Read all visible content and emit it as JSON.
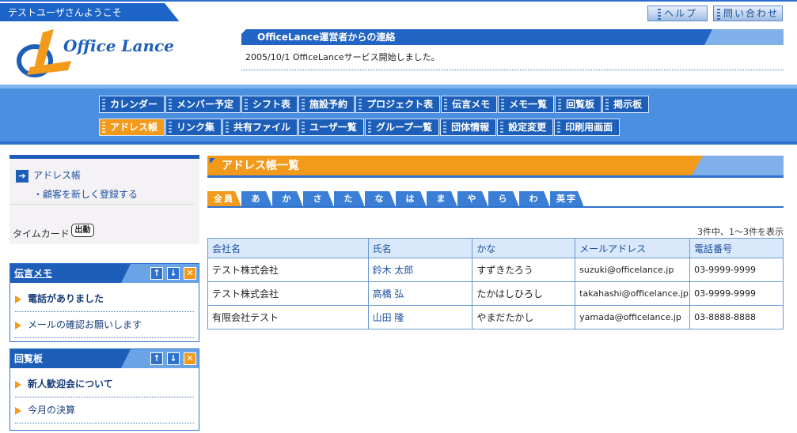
{
  "topbar": {
    "welcome": "テストユーザさんようこそ",
    "help_label": "ヘルプ",
    "contact_label": "問い合わせ"
  },
  "header": {
    "logo_text": "Office Lance",
    "notice_title": "OfficeLance運営者からの連絡",
    "notice_text": "2005/10/1 OfficeLanceサービス開始しました。"
  },
  "menu": {
    "row1": [
      "カレンダー",
      "メンバー予定",
      "シフト表",
      "施設予約",
      "プロジェクト表",
      "伝言メモ",
      "メモ一覧",
      "回覧板",
      "掲示板"
    ],
    "row2": [
      "アドレス帳",
      "リンク集",
      "共有ファイル",
      "ユーザ一覧",
      "グループ一覧",
      "団体情報",
      "設定変更",
      "印刷用画面"
    ],
    "active": "アドレス帳"
  },
  "left": {
    "addressbook_link": "アドレス帳",
    "new_customer_link": "・顧客を新しく登録する",
    "timecard_label": "タイムカード",
    "clockin_label": "出勤"
  },
  "panels": {
    "memo": {
      "title": "伝言メモ",
      "items": [
        "電話がありました",
        "メールの確認お願いします"
      ]
    },
    "circular": {
      "title": "回覧板",
      "items": [
        "新人歓迎会について",
        "今月の決算"
      ]
    }
  },
  "main": {
    "title": "アドレス帳一覧",
    "tabs": [
      "全員",
      "あ",
      "か",
      "さ",
      "た",
      "な",
      "は",
      "ま",
      "や",
      "ら",
      "わ",
      "英字"
    ],
    "active_tab": "全員",
    "count_text": "3件中、1〜3件を表示",
    "columns": [
      "会社名",
      "氏名",
      "かな",
      "メールアドレス",
      "電話番号"
    ],
    "rows": [
      [
        "テスト株式会社",
        "鈴木 太郎",
        "すずきたろう",
        "suzuki@officelance.jp",
        "03-9999-9999"
      ],
      [
        "テスト株式会社",
        "高橋 弘",
        "たかはしひろし",
        "takahashi@officelance.jp",
        "03-9999-9999"
      ],
      [
        "有限会社テスト",
        "山田 隆",
        "やまだたかし",
        "yamada@officelance.jp",
        "03-8888-8888"
      ]
    ]
  },
  "colors": {
    "brand_blue": "#1d5fb8",
    "accent_orange": "#f39a1a",
    "light_blue": "#4b8fe0"
  }
}
